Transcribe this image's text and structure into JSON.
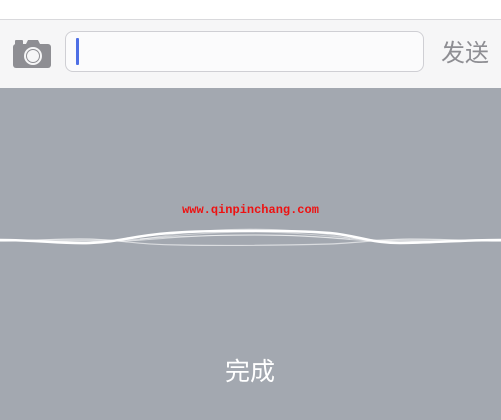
{
  "input_bar": {
    "camera_icon": "camera-icon",
    "field_value": "",
    "send_label": "发送"
  },
  "dictation": {
    "watermark": "www.qinpinchang.com",
    "done_label": "完成"
  },
  "colors": {
    "input_bar_bg": "#f6f6f7",
    "panel_bg": "#a3a8b0",
    "caret": "#4e6fe5",
    "send_text": "#8e8e93",
    "watermark": "#ee1111",
    "done_text": "#ffffff"
  }
}
